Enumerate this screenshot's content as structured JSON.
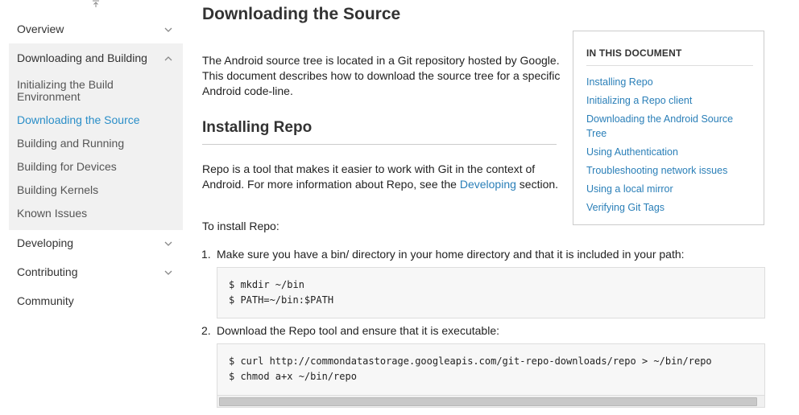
{
  "sidebar": {
    "sections": [
      {
        "label": "Overview"
      },
      {
        "label": "Downloading and Building"
      },
      {
        "label": "Developing"
      },
      {
        "label": "Contributing"
      },
      {
        "label": "Community"
      }
    ],
    "sub_items": [
      {
        "label": "Initializing the Build Environment"
      },
      {
        "label": "Downloading the Source"
      },
      {
        "label": "Building and Running"
      },
      {
        "label": "Building for Devices"
      },
      {
        "label": "Building Kernels"
      },
      {
        "label": "Known Issues"
      }
    ]
  },
  "page": {
    "title": "Downloading the Source",
    "intro": "The Android source tree is located in a Git repository hosted by Google. This document describes how to download the source tree for a specific Android code-line.",
    "section_title": "Installing Repo",
    "repo_desc_1": "Repo is a tool that makes it easier to work with Git in the context of Android. For more information about Repo, see the ",
    "repo_desc_link": "Developing",
    "repo_desc_2": " section.",
    "to_install": "To install Repo:",
    "steps": [
      {
        "num": "1.",
        "text": "Make sure you have a bin/ directory in your home directory and that it is included in your path:"
      },
      {
        "num": "2.",
        "text": "Download the Repo tool and ensure that it is executable:"
      }
    ]
  },
  "code_blocks": [
    {
      "lines": [
        "$ mkdir ~/bin",
        "$ PATH=~/bin:$PATH"
      ]
    },
    {
      "lines": [
        "$ curl http://commondatastorage.googleapis.com/git-repo-downloads/repo > ~/bin/repo",
        "$ chmod a+x ~/bin/repo"
      ]
    }
  ],
  "toc": {
    "title": "IN THIS DOCUMENT",
    "links": [
      {
        "label": "Installing Repo"
      },
      {
        "label": "Initializing a Repo client"
      },
      {
        "label": "Downloading the Android Source Tree"
      },
      {
        "label": "Using Authentication"
      },
      {
        "label": "Troubleshooting network issues"
      },
      {
        "label": "Using a local mirror"
      },
      {
        "label": "Verifying Git Tags"
      }
    ]
  },
  "colors": {
    "link": "#2a7fb8",
    "active_nav": "#2a8ec8",
    "nav_open_bg": "#f1f1f1"
  },
  "icons": {
    "expand": "chevron-down-icon",
    "collapse": "chevron-up-icon"
  }
}
